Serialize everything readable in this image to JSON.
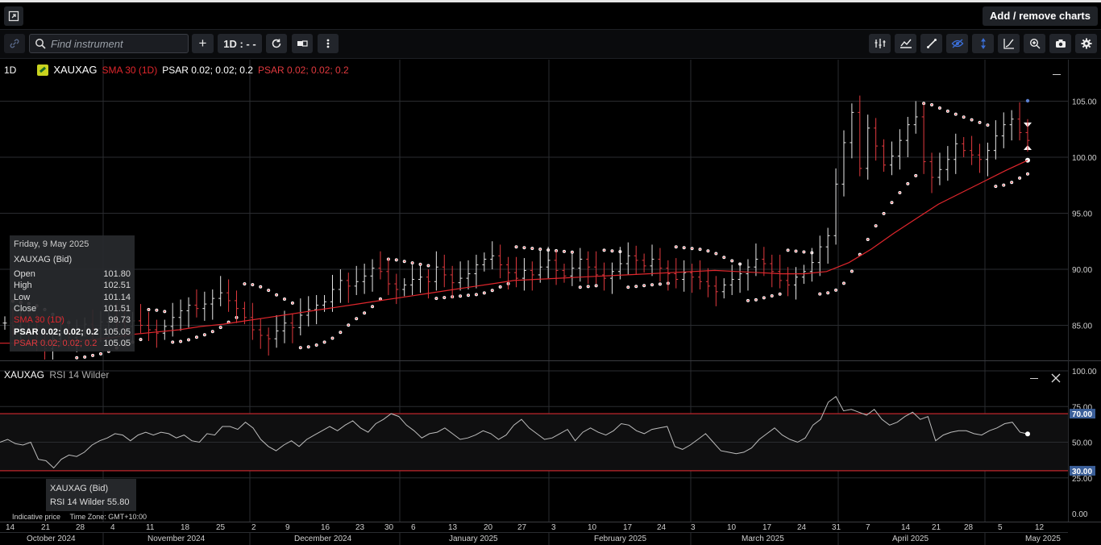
{
  "app": {
    "add_remove_label": "Add / remove charts",
    "search_placeholder": "Find instrument",
    "interval_label": "1D : - -",
    "add_symbol": "+",
    "icons": [
      "link-icon",
      "search-icon",
      "plus-icon",
      "refresh-icon",
      "layout-icon",
      "more-vert-icon",
      "indicators-icon",
      "chart-type-icon",
      "draw-icon",
      "visibility-icon",
      "crosshair-icon",
      "curve-icon",
      "zoom-icon",
      "camera-icon",
      "settings-icon"
    ]
  },
  "legend": {
    "interval": "1D",
    "symbol": "XAUXAG",
    "sma": "SMA 30 (1D)",
    "psar1": "PSAR 0.02; 0.02; 0.2",
    "psar2": "PSAR 0.02; 0.02; 0.2"
  },
  "tooltip": {
    "date": "Friday, 9 May 2025",
    "instrument": "XAUXAG (Bid)",
    "rows": [
      {
        "label": "Open",
        "value": "101.80"
      },
      {
        "label": "High",
        "value": "102.51"
      },
      {
        "label": "Low",
        "value": "101.14"
      },
      {
        "label": "Close",
        "value": "101.51"
      },
      {
        "label": "SMA 30 (1D)",
        "value": "99.73"
      },
      {
        "label": "PSAR 0.02; 0.02; 0.2",
        "value": "105.05"
      },
      {
        "label": "PSAR 0.02; 0.02; 0.2",
        "value": "105.05"
      }
    ]
  },
  "rsi": {
    "title": "XAUXAG",
    "name": "RSI 14 Wilder",
    "tooltip_instrument": "XAUXAG (Bid)",
    "tooltip_value": "RSI 14 Wilder 55.80",
    "overbought": "70.00",
    "oversold": "30.00",
    "ticks": [
      "100.00",
      "75.00",
      "50.00",
      "25.00",
      "0.00"
    ]
  },
  "footer": {
    "indicative": "Indicative price",
    "timezone": "Time Zone: GMT+10:00"
  },
  "colors": {
    "up": "#e8e8e8",
    "down": "#e0393e",
    "sma": "#e0262c",
    "psar_white": "#ffffff",
    "psar_red": "#e0393e",
    "rsi_band": "#c0262b",
    "highlight_label": "#3b5f99"
  },
  "chart_data": {
    "type": "candlestick-ohlc",
    "symbol": "XAUXAG",
    "y_ticks": [
      "105.00",
      "100.00",
      "95.00",
      "90.00",
      "85.00"
    ],
    "ylim": [
      82,
      108
    ],
    "x_day_labels": [
      "14",
      "21",
      "28",
      "4",
      "11",
      "18",
      "25",
      "2",
      "9",
      "16",
      "23",
      "30",
      "6",
      "13",
      "20",
      "27",
      "3",
      "10",
      "17",
      "24",
      "3",
      "10",
      "17",
      "24",
      "31",
      "7",
      "14",
      "21",
      "28",
      "5",
      "12"
    ],
    "x_month_labels": [
      "October 2024",
      "November 2024",
      "December 2024",
      "January 2025",
      "February 2025",
      "March 2025",
      "April 2025",
      "May 2025"
    ],
    "closes": [
      85.2,
      84.9,
      85.6,
      84.6,
      83.5,
      82.9,
      83.8,
      84.3,
      83.9,
      84.6,
      85.1,
      84.7,
      85.3,
      85.6,
      85.2,
      84.9,
      85.4,
      85.0,
      84.6,
      84.3,
      84.9,
      85.7,
      86.3,
      86.8,
      86.5,
      86.9,
      87.4,
      87.9,
      87.2,
      86.5,
      85.7,
      84.6,
      84.1,
      83.8,
      84.5,
      85.2,
      84.8,
      85.9,
      86.4,
      86.8,
      87.1,
      88.2,
      89.0,
      88.5,
      88.9,
      89.4,
      90.1,
      89.8,
      88.7,
      88.2,
      88.6,
      89.1,
      89.3,
      88.9,
      90.2,
      89.5,
      88.8,
      89.2,
      89.6,
      90.4,
      90.9,
      91.2,
      90.4,
      89.7,
      89.2,
      89.9,
      89.5,
      90.2,
      90.8,
      89.9,
      89.4,
      90.1,
      90.9,
      90.2,
      89.5,
      89.2,
      89.8,
      90.5,
      91.2,
      90.8,
      90.3,
      90.9,
      90.1,
      89.6,
      89.1,
      89.7,
      89.3,
      88.9,
      88.5,
      88.0,
      88.6,
      89.1,
      89.6,
      90.2,
      90.9,
      90.5,
      89.8,
      89.0,
      88.6,
      89.3,
      89.8,
      90.6,
      92.0,
      93.0,
      97.6,
      101.3,
      104.0,
      99.0,
      102.6,
      101.0,
      99.3,
      100.1,
      101.5,
      102.9,
      103.6,
      99.6,
      98.2,
      98.9,
      99.8,
      101.2,
      100.6,
      100.2,
      99.8,
      100.6,
      101.9,
      102.9,
      103.4,
      102.2,
      101.5
    ],
    "sma": [
      83.4,
      83.4,
      83.5,
      83.6,
      83.7,
      83.9,
      84.2,
      84.4,
      84.6,
      84.9,
      85.1,
      85.4,
      85.7,
      86.0,
      86.3,
      86.6,
      86.9,
      87.2,
      87.5,
      87.8,
      88.1,
      88.4,
      88.7,
      89.0,
      89.1,
      89.2,
      89.3,
      89.4,
      89.5,
      89.6,
      89.7,
      89.8,
      89.9,
      89.8,
      89.7,
      89.6,
      89.6,
      89.8,
      90.6,
      91.8,
      93.2,
      94.5,
      95.8,
      96.8,
      97.8,
      98.8,
      99.73
    ],
    "rsi": [
      50,
      52,
      49,
      48,
      50,
      38,
      37,
      32,
      38,
      41,
      40,
      43,
      48,
      51,
      53,
      56,
      55,
      51,
      55,
      57,
      55,
      57,
      56,
      53,
      55,
      51,
      50,
      56,
      55,
      61,
      61,
      59,
      64,
      60,
      52,
      47,
      44,
      48,
      51,
      47,
      52,
      55,
      58,
      61,
      58,
      62,
      65,
      60,
      57,
      63,
      66,
      70,
      68,
      62,
      58,
      53,
      56,
      57,
      60,
      56,
      52,
      53,
      55,
      58,
      56,
      52,
      55,
      62,
      66,
      60,
      56,
      52,
      53,
      56,
      59,
      51,
      57,
      60,
      57,
      55,
      58,
      63,
      62,
      58,
      56,
      59,
      60,
      61,
      47,
      45,
      48,
      52,
      56,
      50,
      44,
      43,
      42,
      43,
      46,
      52,
      56,
      60,
      55,
      52,
      50,
      53,
      62,
      66,
      78,
      82,
      72,
      73,
      71,
      69,
      73,
      66,
      62,
      64,
      68,
      71,
      66,
      68,
      51,
      55,
      57,
      58,
      58,
      56,
      55,
      58,
      60,
      63,
      64,
      57,
      55.8
    ],
    "current_close_label_y": 101.51
  }
}
